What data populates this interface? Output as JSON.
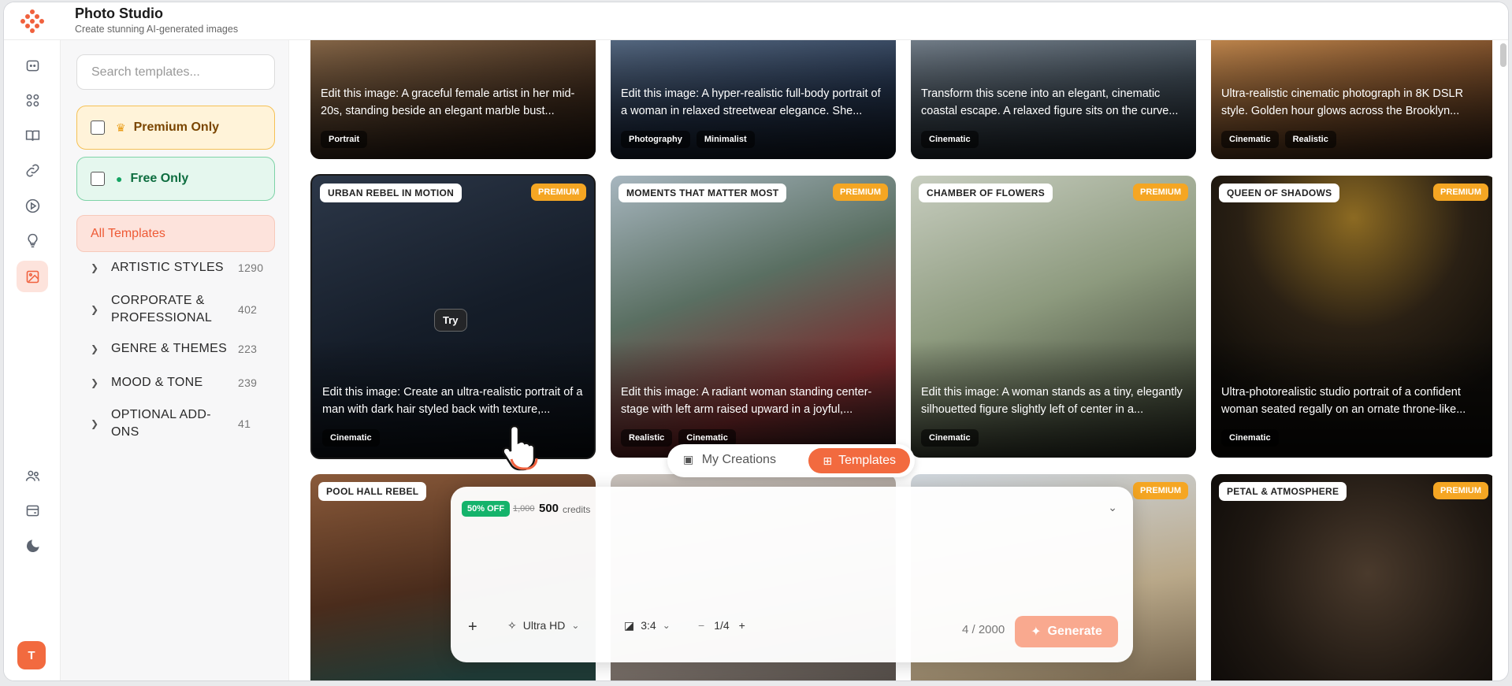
{
  "header": {
    "title": "Photo Studio",
    "subtitle": "Create stunning AI-generated images"
  },
  "rail": {
    "avatar_initial": "T"
  },
  "filters": {
    "search_placeholder": "Search templates...",
    "premium_only": "Premium Only",
    "free_only": "Free Only",
    "all_templates": "All Templates",
    "categories": [
      {
        "name": "ARTISTIC STYLES",
        "count": "1290"
      },
      {
        "name": "CORPORATE & PROFESSIONAL",
        "count": "402"
      },
      {
        "name": "GENRE & THEMES",
        "count": "223"
      },
      {
        "name": "MOOD & TONE",
        "count": "239"
      },
      {
        "name": "OPTIONAL ADD-ONS",
        "count": "41"
      }
    ]
  },
  "cards_top": [
    {
      "desc": "Edit this image: A graceful female artist in her mid-20s, standing beside an elegant marble bust...",
      "tags": [
        "Portrait"
      ]
    },
    {
      "desc": "Edit this image: A hyper-realistic full-body portrait of a woman in relaxed streetwear elegance. She...",
      "tags": [
        "Photography",
        "Minimalist"
      ]
    },
    {
      "desc": "Transform this scene into an elegant, cinematic coastal escape. A relaxed figure sits on the curve...",
      "tags": [
        "Cinematic"
      ]
    },
    {
      "desc": "Ultra-realistic cinematic photograph in 8K DSLR style. Golden hour glows across the Brooklyn...",
      "tags": [
        "Cinematic",
        "Realistic"
      ]
    }
  ],
  "cards_mid": [
    {
      "title": "URBAN REBEL IN MOTION",
      "premium": "PREMIUM",
      "desc": "Edit this image: Create an ultra-realistic portrait of a man with dark hair styled back with texture,...",
      "tags": [
        "Cinematic"
      ],
      "try": "Try"
    },
    {
      "title": "MOMENTS THAT MATTER MOST",
      "premium": "PREMIUM",
      "desc": "Edit this image: A radiant woman standing center-stage with left arm raised upward in a joyful,...",
      "tags": [
        "Realistic",
        "Cinematic"
      ]
    },
    {
      "title": "CHAMBER OF FLOWERS",
      "premium": "PREMIUM",
      "desc": "Edit this image: A woman stands as a tiny, elegantly silhouetted figure slightly left of center in a...",
      "tags": [
        "Cinematic"
      ]
    },
    {
      "title": "QUEEN OF SHADOWS",
      "premium": "PREMIUM",
      "desc": "Ultra-photorealistic studio portrait of a confident woman seated regally on an ornate throne-like...",
      "tags": [
        "Cinematic"
      ]
    }
  ],
  "cards_bottom": [
    {
      "title": "POOL HALL REBEL"
    },
    {
      "title": ""
    },
    {
      "title": "",
      "premium": "PREMIUM"
    },
    {
      "title": "PETAL & ATMOSPHERE",
      "premium": "PREMIUM"
    }
  ],
  "view_tabs": {
    "my_creations": "My Creations",
    "templates": "Templates"
  },
  "composer": {
    "discount": "50% OFF",
    "old_price": "1,000",
    "credits": "500",
    "credits_label": "credits",
    "quality": "Ultra HD",
    "ratio": "3:4",
    "count": "1/4",
    "char_counter": "4 / 2000",
    "generate": "Generate"
  }
}
